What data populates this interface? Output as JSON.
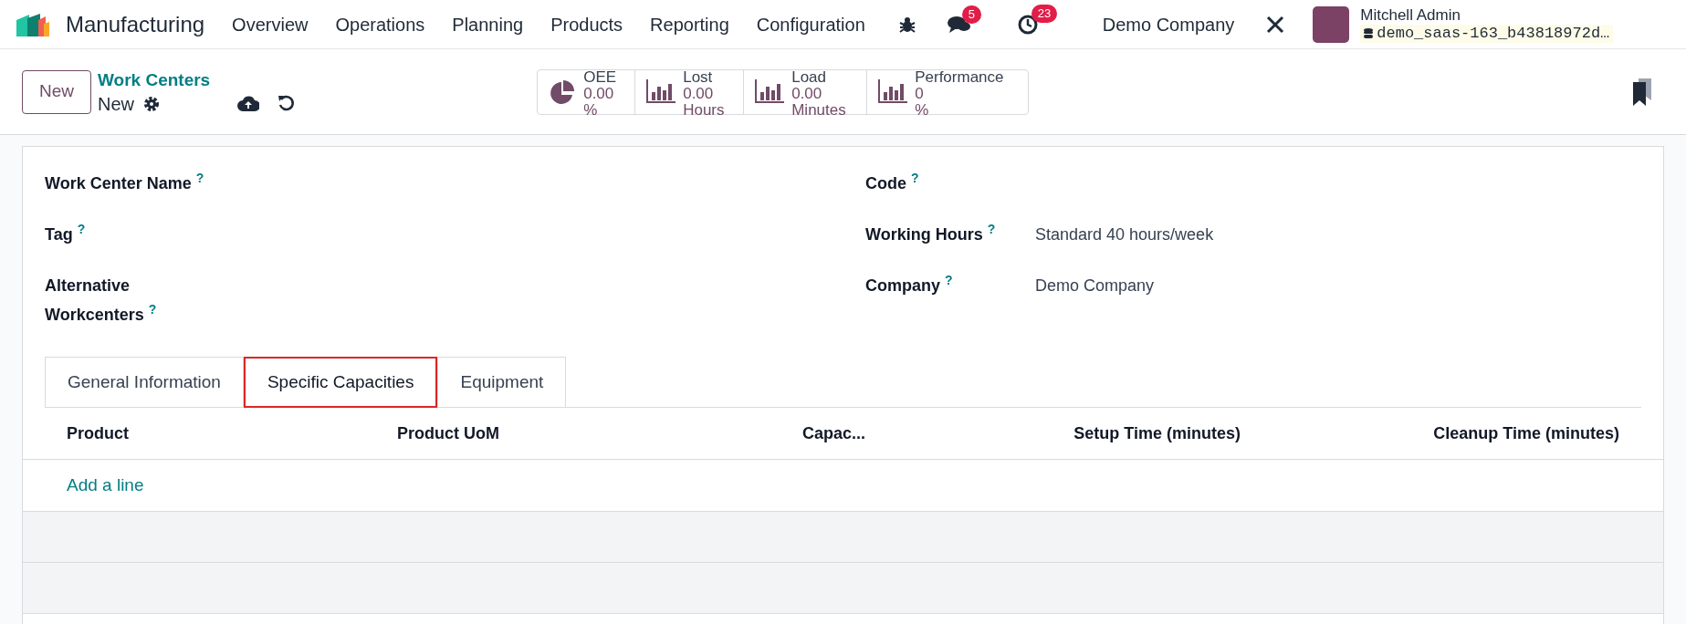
{
  "navbar": {
    "app_name": "Manufacturing",
    "menu": [
      "Overview",
      "Operations",
      "Planning",
      "Products",
      "Reporting",
      "Configuration"
    ],
    "messages_badge": "5",
    "activities_badge": "23",
    "company": "Demo Company",
    "user_name": "Mitchell Admin",
    "database": "demo_saas-163_b43818972d…"
  },
  "control_panel": {
    "new_button": "New",
    "breadcrumb": "Work Centers",
    "record_name": "New",
    "stat_buttons": [
      {
        "kind": "pie",
        "label": "OEE",
        "value": "0.00",
        "unit": "%"
      },
      {
        "kind": "bars",
        "label": "Lost",
        "value": "0.00",
        "unit": "Hours"
      },
      {
        "kind": "bars",
        "label": "Load",
        "value": "0.00",
        "unit": "Minutes"
      },
      {
        "kind": "bars",
        "label": "Performance",
        "value": "0",
        "unit": "%"
      }
    ]
  },
  "form": {
    "fields_left": [
      {
        "label": "Work Center Name",
        "help": "?"
      },
      {
        "label": "Tag",
        "help": "?"
      },
      {
        "label": "Alternative Workcenters",
        "help": "?"
      }
    ],
    "fields_right": [
      {
        "label": "Code",
        "help": "?"
      },
      {
        "label": "Working Hours",
        "help": "?",
        "value": "Standard 40 hours/week"
      },
      {
        "label": "Company",
        "help": "?",
        "value": "Demo Company"
      }
    ]
  },
  "tabs": [
    {
      "label": "General Information",
      "selected": false
    },
    {
      "label": "Specific Capacities",
      "selected": true
    },
    {
      "label": "Equipment",
      "selected": false
    }
  ],
  "table": {
    "columns": [
      "Product",
      "Product UoM",
      "Capac...",
      "Setup Time (minutes)",
      "Cleanup Time (minutes)"
    ],
    "add_line": "Add a line"
  }
}
